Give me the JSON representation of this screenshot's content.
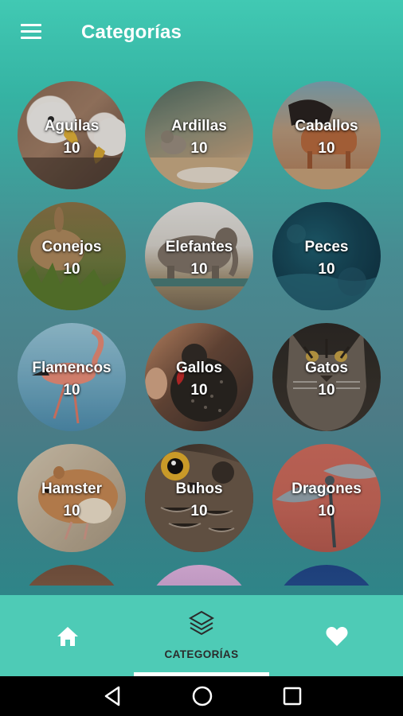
{
  "app": {
    "title": "Categorías"
  },
  "categories": [
    {
      "name": "Aguilas",
      "count": "10"
    },
    {
      "name": "Ardillas",
      "count": "10"
    },
    {
      "name": "Caballos",
      "count": "10"
    },
    {
      "name": "Conejos",
      "count": "10"
    },
    {
      "name": "Elefantes",
      "count": "10"
    },
    {
      "name": "Peces",
      "count": "10"
    },
    {
      "name": "Flamencos",
      "count": "10"
    },
    {
      "name": "Gallos",
      "count": "10"
    },
    {
      "name": "Gatos",
      "count": "10"
    },
    {
      "name": "Hamster",
      "count": "10"
    },
    {
      "name": "Buhos",
      "count": "10"
    },
    {
      "name": "Dragones",
      "count": "10"
    }
  ],
  "bottom_nav": {
    "home_icon": "home-icon",
    "categories_icon": "layers-icon",
    "categories_label": "CATEGORÍAS",
    "favorites_icon": "heart-icon",
    "active_tab": "categories"
  },
  "colors": {
    "accent": "#41c9b3",
    "bottom_nav_bg": "#4ecbb6",
    "nav_label": "#2b2b2b"
  }
}
